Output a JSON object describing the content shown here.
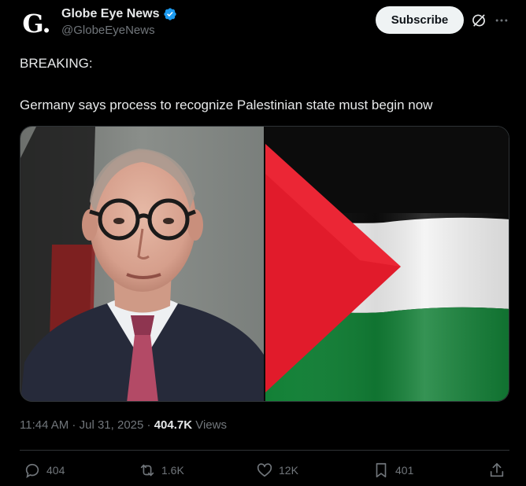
{
  "account": {
    "avatar_letter": "G.",
    "display_name": "Globe Eye News",
    "handle": "@GlobeEyeNews",
    "verified": true
  },
  "header": {
    "subscribe_label": "Subscribe",
    "icons": [
      "grok-icon",
      "more-icon"
    ]
  },
  "post": {
    "line1": "BREAKING:",
    "line2": "Germany says process to recognize Palestinian state must begin now"
  },
  "media": {
    "images": [
      "portrait-photo",
      "palestinian-flag-image"
    ]
  },
  "meta": {
    "time": "11:44 AM",
    "separator1": " · ",
    "date": "Jul 31, 2025",
    "separator2": " · ",
    "views_count": "404.7K",
    "views_label": " Views"
  },
  "actions": {
    "replies": "404",
    "reposts": "1.6K",
    "likes": "12K",
    "bookmarks": "401"
  },
  "colors": {
    "background": "#000000",
    "text": "#e7e9ea",
    "muted": "#71767b",
    "verified": "#1d9bf0",
    "subscribe_bg": "#eff3f4"
  }
}
